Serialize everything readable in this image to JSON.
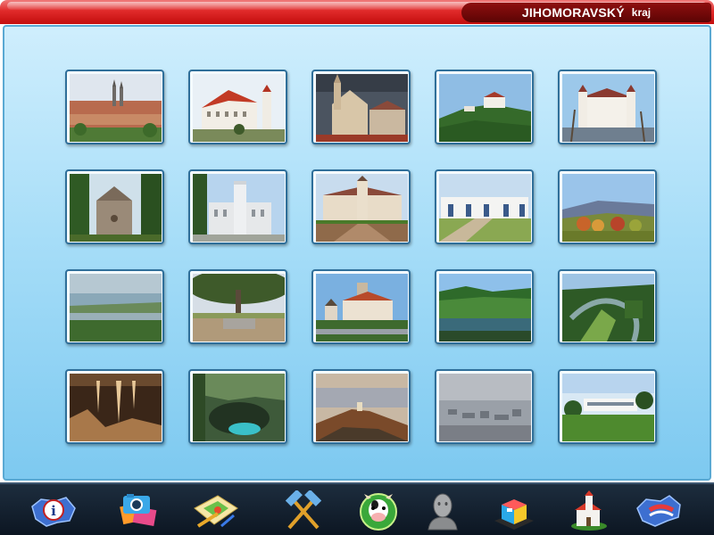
{
  "header": {
    "region_name": "JIHOMORAVSKÝ",
    "region_suffix": "kraj"
  },
  "gallery": {
    "photos": [
      {
        "subject": "city-panorama-with-cathedral"
      },
      {
        "subject": "white-chateau-red-roof"
      },
      {
        "subject": "gothic-church-stormy-sky"
      },
      {
        "subject": "castle-on-wooded-hill"
      },
      {
        "subject": "white-castle-with-towers"
      },
      {
        "subject": "round-tower-in-forest"
      },
      {
        "subject": "neo-gothic-chateau"
      },
      {
        "subject": "baroque-palace-with-garden"
      },
      {
        "subject": "white-wine-cellars"
      },
      {
        "subject": "autumn-hills-landscape"
      },
      {
        "subject": "lake-valley-view"
      },
      {
        "subject": "monument-under-tree"
      },
      {
        "subject": "castle-with-church-and-bridge"
      },
      {
        "subject": "river-in-green-valley"
      },
      {
        "subject": "river-meander-canyon"
      },
      {
        "subject": "cave-stalactites"
      },
      {
        "subject": "abyss-with-blue-lake"
      },
      {
        "subject": "ruin-above-reservoir"
      },
      {
        "subject": "foggy-town-view"
      },
      {
        "subject": "modern-white-villa"
      }
    ]
  },
  "toolbar": {
    "items": [
      {
        "icon": "info-map-icon"
      },
      {
        "icon": "photo-gallery-icon"
      },
      {
        "icon": "map-drawing-icon"
      },
      {
        "icon": "crossed-hammers-icon"
      },
      {
        "icon": "cow-mascot-icon"
      },
      {
        "icon": "bust-statue-icon"
      },
      {
        "icon": "3d-cube-icon"
      },
      {
        "icon": "church-building-icon"
      },
      {
        "icon": "czech-map-icon"
      }
    ]
  },
  "colors": {
    "header_red": "#d91a1a",
    "header_tab": "#7a0909",
    "panel_top": "#cfeefd",
    "panel_bottom": "#7dc9f0",
    "toolbar_bg": "#13202e"
  }
}
